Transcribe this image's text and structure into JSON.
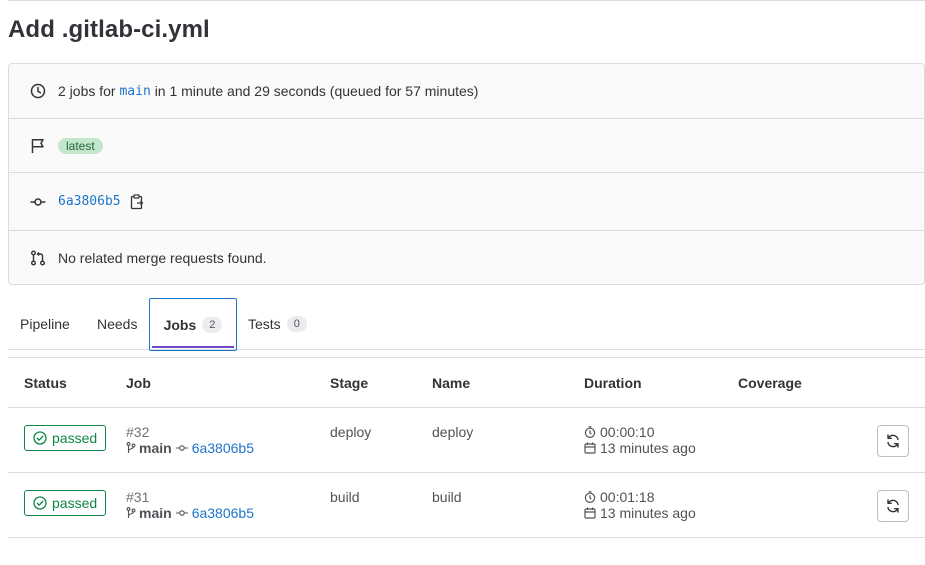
{
  "page": {
    "title": "Add .gitlab-ci.yml"
  },
  "summary": {
    "jobs_prefix": "2 jobs for",
    "branch": "main",
    "jobs_suffix": "in 1 minute and 29 seconds (queued for 57 minutes)",
    "tag_badge": "latest",
    "commit_sha": "6a3806b5",
    "merge_requests_text": "No related merge requests found."
  },
  "tabs": [
    {
      "label": "Pipeline"
    },
    {
      "label": "Needs"
    },
    {
      "label": "Jobs",
      "count": "2",
      "active": true
    },
    {
      "label": "Tests",
      "count": "0"
    }
  ],
  "table": {
    "headers": [
      "Status",
      "Job",
      "Stage",
      "Name",
      "Duration",
      "Coverage"
    ],
    "rows": [
      {
        "status": "passed",
        "job_id": "#32",
        "branch": "main",
        "commit": "6a3806b5",
        "stage": "deploy",
        "name": "deploy",
        "duration": "00:00:10",
        "finished": "13 minutes ago",
        "coverage": ""
      },
      {
        "status": "passed",
        "job_id": "#31",
        "branch": "main",
        "commit": "6a3806b5",
        "stage": "build",
        "name": "build",
        "duration": "00:01:18",
        "finished": "13 minutes ago",
        "coverage": ""
      }
    ]
  },
  "icons": {
    "clock": "clock-icon",
    "flag": "flag-icon",
    "commit": "commit-icon",
    "merge_request": "merge-request-icon",
    "copy": "copy-to-clipboard-icon",
    "status_success": "status-success-icon",
    "branch": "branch-icon",
    "timer": "timer-icon",
    "calendar": "calendar-icon",
    "retry": "retry-icon"
  },
  "colors": {
    "link": "#1f75cb",
    "success": "#108548",
    "badge_bg": "#c3e6cd",
    "active_tab_underline": "#6e49cb",
    "border": "#dcdcde"
  }
}
